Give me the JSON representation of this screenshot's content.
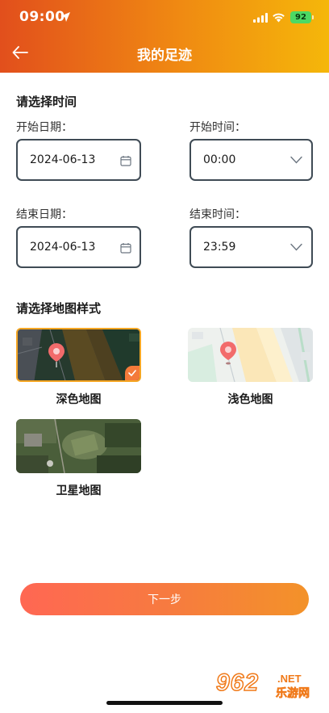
{
  "status_bar": {
    "time": "09:00",
    "battery": "92"
  },
  "header": {
    "title": "我的足迹"
  },
  "time_section": {
    "title": "请选择时间",
    "start_date_label": "开始日期：",
    "start_date_value": "2024-06-13",
    "start_time_label": "开始时间：",
    "start_time_value": "00:00",
    "end_date_label": "结束日期：",
    "end_date_value": "2024-06-13",
    "end_time_label": "结束时间：",
    "end_time_value": "23:59"
  },
  "map_section": {
    "title": "请选择地图样式",
    "styles": [
      {
        "label": "深色地图",
        "selected": true
      },
      {
        "label": "浅色地图",
        "selected": false
      },
      {
        "label": "卫星地图",
        "selected": false
      }
    ]
  },
  "next_button": {
    "label": "下一步"
  },
  "watermark": {
    "number": "962",
    "domain": ".NET",
    "text": "乐游网"
  },
  "colors": {
    "header_start": "#e24f1c",
    "header_end": "#f5b70a",
    "button_start": "#ff6753",
    "button_end": "#f39229",
    "selected_border": "#f5a623"
  }
}
